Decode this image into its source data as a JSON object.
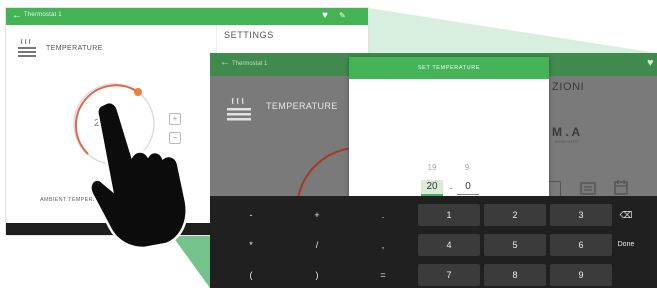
{
  "left_screen": {
    "app_name": "Thermostat 1",
    "section_title": "TEMPERATURE",
    "settings_title": "SETTINGS",
    "dial_value": "20.0°",
    "plus_label": "+",
    "minus_label": "−",
    "ambient_label": "AMBIENT TEMPERATURE"
  },
  "right_screen": {
    "app_name": "Thermostat 1",
    "section_title": "TEMPERATURE",
    "settings_partial": "ZIONI",
    "mode_values": "M . A",
    "mode_sub": "MAN      AUTO",
    "dialog": {
      "title": "SET TEMPERATURE",
      "prev_integer": "19",
      "prev_decimal": "9",
      "integer": "20",
      "separator": ".",
      "decimal": "0"
    },
    "keyboard": {
      "row1": [
        "-",
        "+",
        ".",
        "1",
        "2",
        "3",
        "⌫"
      ],
      "row2": [
        "*",
        "/",
        ",",
        "4",
        "5",
        "6",
        "Done"
      ],
      "row3": [
        "(",
        ")",
        "=",
        "7",
        "8",
        "9"
      ]
    }
  },
  "colors": {
    "accent_green": "#45b357",
    "topbar_green": "#43b356",
    "dimmed_topbar": "#3f8a4c",
    "projection_green": "#6fbf86",
    "dial_red": "#e0674e",
    "dial_knob": "#f07f3a",
    "keyboard_bg": "#202020"
  },
  "icons": {
    "back": "←",
    "heart": "♥",
    "pencil": "✎",
    "backspace": "⌫"
  }
}
